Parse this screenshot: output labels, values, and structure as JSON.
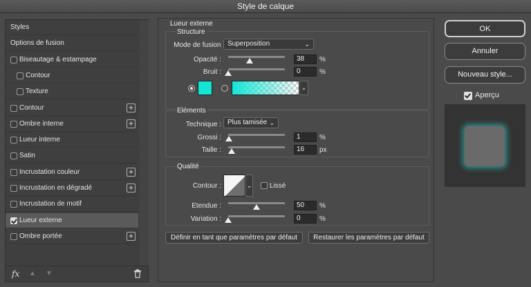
{
  "window": {
    "title": "Style de calque"
  },
  "left_panel": {
    "items": [
      {
        "label": "Styles",
        "checkbox": null,
        "checked": false,
        "add": false,
        "selected": false
      },
      {
        "label": "Options de fusion",
        "checkbox": null,
        "checked": false,
        "add": false,
        "selected": false
      },
      {
        "label": "Biseautage & estampage",
        "checkbox": true,
        "checked": false,
        "add": false,
        "selected": false
      },
      {
        "label": "Contour",
        "checkbox": true,
        "checked": false,
        "add": false,
        "selected": false,
        "indent": true
      },
      {
        "label": "Texture",
        "checkbox": true,
        "checked": false,
        "add": false,
        "selected": false,
        "indent": true
      },
      {
        "label": "Contour",
        "checkbox": true,
        "checked": false,
        "add": true,
        "selected": false
      },
      {
        "label": "Ombre interne",
        "checkbox": true,
        "checked": false,
        "add": true,
        "selected": false
      },
      {
        "label": "Lueur interne",
        "checkbox": true,
        "checked": false,
        "add": false,
        "selected": false
      },
      {
        "label": "Satin",
        "checkbox": true,
        "checked": false,
        "add": false,
        "selected": false
      },
      {
        "label": "Incrustation couleur",
        "checkbox": true,
        "checked": false,
        "add": true,
        "selected": false
      },
      {
        "label": "Incrustation en dégradé",
        "checkbox": true,
        "checked": false,
        "add": true,
        "selected": false
      },
      {
        "label": "Incrustation de motif",
        "checkbox": true,
        "checked": false,
        "add": false,
        "selected": false
      },
      {
        "label": "Lueur externe",
        "checkbox": true,
        "checked": true,
        "add": false,
        "selected": true
      },
      {
        "label": "Ombre portée",
        "checkbox": true,
        "checked": false,
        "add": true,
        "selected": false
      }
    ],
    "footer": {
      "fx_label": "fx"
    }
  },
  "panel": {
    "title": "Lueur externe",
    "structure": {
      "title": "Structure",
      "blend_mode_label": "Mode de fusion :",
      "blend_mode_value": "Superposition",
      "opacity_label": "Opacité :",
      "opacity_value": "38",
      "opacity_fraction": 0.38,
      "opacity_unit": "%",
      "noise_label": "Bruit :",
      "noise_value": "0",
      "noise_fraction": 0,
      "noise_unit": "%",
      "color_swatch": "#14e6d6"
    },
    "elements": {
      "title": "Eléments",
      "technique_label": "Technique :",
      "technique_value": "Plus tamisée",
      "spread_label": "Grossi :",
      "spread_value": "1",
      "spread_fraction": 0.01,
      "spread_unit": "%",
      "size_label": "Taille :",
      "size_value": "16",
      "size_fraction": 0.064,
      "size_unit": "px"
    },
    "quality": {
      "title": "Qualité",
      "contour_label": "Contour :",
      "antialias_label": "Lissé",
      "range_label": "Etendue :",
      "range_value": "50",
      "range_fraction": 0.5,
      "range_unit": "%",
      "jitter_label": "Variation :",
      "jitter_value": "0",
      "jitter_fraction": 0,
      "jitter_unit": "%"
    },
    "buttons": {
      "make_default": "Définir en tant que paramètres par défaut",
      "reset_default": "Restaurer les paramètres par défaut"
    }
  },
  "right": {
    "ok": "OK",
    "cancel": "Annuler",
    "new_style": "Nouveau style...",
    "preview_label": "Aperçu",
    "preview_checked": true,
    "glow_color": "#29d8d0"
  }
}
